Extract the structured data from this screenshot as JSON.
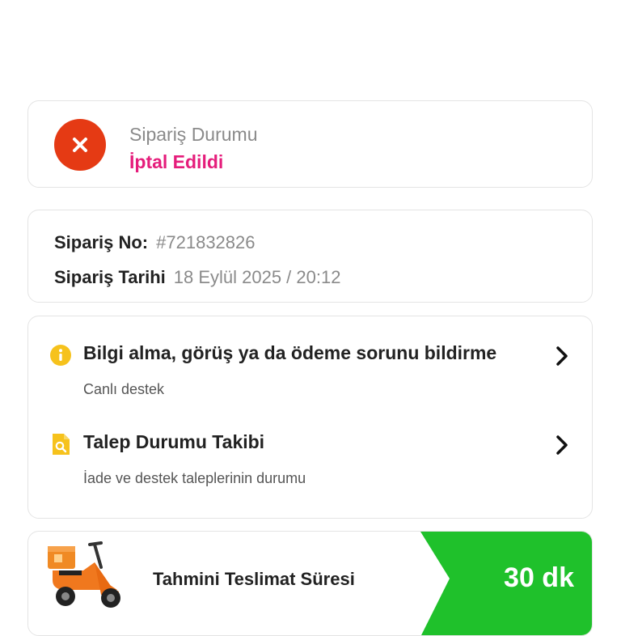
{
  "order_status": {
    "title": "Sipariş Durumu",
    "value": "İptal Edildi",
    "icon": "close-icon",
    "status_color": "#e53a14",
    "value_color": "#e51d7b"
  },
  "order_info": {
    "number_label": "Sipariş No:",
    "number_value": "#721832826",
    "date_label": "Sipariş Tarihi",
    "date_value": "18 Eylül 2025 / 20:12"
  },
  "support": {
    "items": [
      {
        "title": "Bilgi alma, görüş ya da ödeme sorunu bildirme",
        "subtitle": "Canlı destek",
        "icon": "info-icon"
      },
      {
        "title": "Talep Durumu Takibi",
        "subtitle": "İade ve destek taleplerinin durumu",
        "icon": "document-search-icon"
      }
    ]
  },
  "delivery": {
    "label": "Tahmini Teslimat Süresi",
    "time": "30 dk",
    "accent_color": "#1fc12b",
    "icon": "scooter-icon"
  }
}
